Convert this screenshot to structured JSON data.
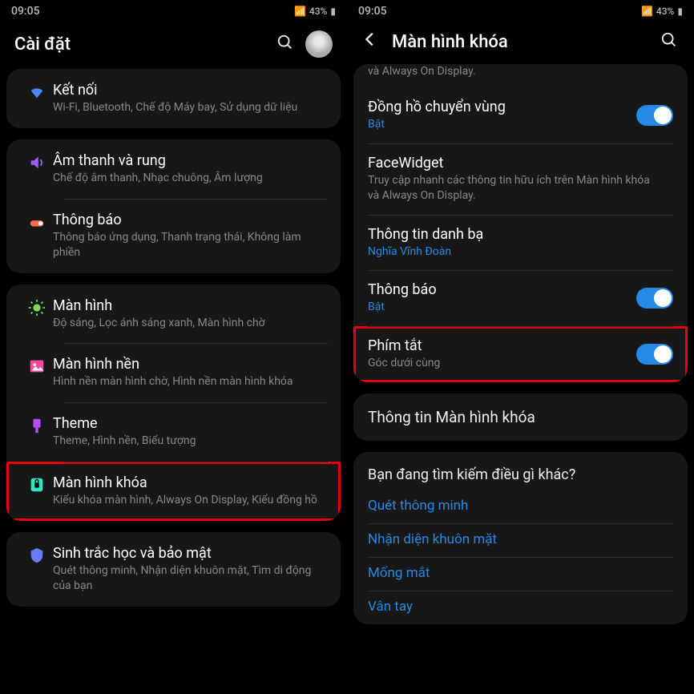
{
  "status": {
    "time": "09:05",
    "battery": "43%"
  },
  "left": {
    "title": "Cài đặt",
    "groups": [
      [
        {
          "icon": "wifi-icon",
          "title": "Kết nối",
          "sub": "Wi-Fi, Bluetooth, Chế độ Máy bay, Sử dụng dữ liệu"
        }
      ],
      [
        {
          "icon": "sound-icon",
          "title": "Âm thanh và rung",
          "sub": "Chế độ âm thanh, Nhạc chuông, Âm lượng"
        },
        {
          "icon": "notification-icon",
          "title": "Thông báo",
          "sub": "Thông báo ứng dụng, Thanh trạng thái, Không làm phiền"
        }
      ],
      [
        {
          "icon": "display-icon",
          "title": "Màn hình",
          "sub": "Độ sáng, Lọc ánh sáng xanh, Màn hình chờ"
        },
        {
          "icon": "wallpaper-icon",
          "title": "Màn hình nền",
          "sub": "Hình nền màn hình chờ, Hình nền màn hình khóa"
        },
        {
          "icon": "theme-icon",
          "title": "Theme",
          "sub": "Theme, Hình nền, Biểu tượng"
        },
        {
          "icon": "lock-icon",
          "title": "Màn hình khóa",
          "sub": "Kiểu khóa màn hình, Always On Display, Kiểu đồng hồ",
          "highlight": true
        }
      ],
      [
        {
          "icon": "biometric-icon",
          "title": "Sinh trắc học và bảo mật",
          "sub": "Quét thông minh, Nhận diện khuôn mặt, Tìm di động của bạn"
        }
      ]
    ]
  },
  "right": {
    "title": "Màn hình khóa",
    "intro": "và Always On Display.",
    "items": [
      {
        "title": "Đồng hồ chuyển vùng",
        "sub": "Bật",
        "subBlue": true,
        "toggle": true
      },
      {
        "title": "FaceWidget",
        "sub": "Truy cập nhanh các thông tin hữu ích trên Màn hình khóa và Always On Display."
      },
      {
        "title": "Thông tin danh bạ",
        "sub": "Nghĩa Vĩnh Đoàn",
        "subBlue": true
      },
      {
        "title": "Thông báo",
        "sub": "Bật",
        "subBlue": true,
        "toggle": true
      },
      {
        "title": "Phím tắt",
        "sub": "Góc dưới cùng",
        "toggle": true,
        "highlight": true
      }
    ],
    "info_section": "Thông tin Màn hình khóa",
    "help": {
      "title": "Bạn đang tìm kiếm điều gì khác?",
      "links": [
        "Quét thông minh",
        "Nhận diện khuôn mặt",
        "Mống mắt",
        "Vân tay"
      ]
    }
  }
}
